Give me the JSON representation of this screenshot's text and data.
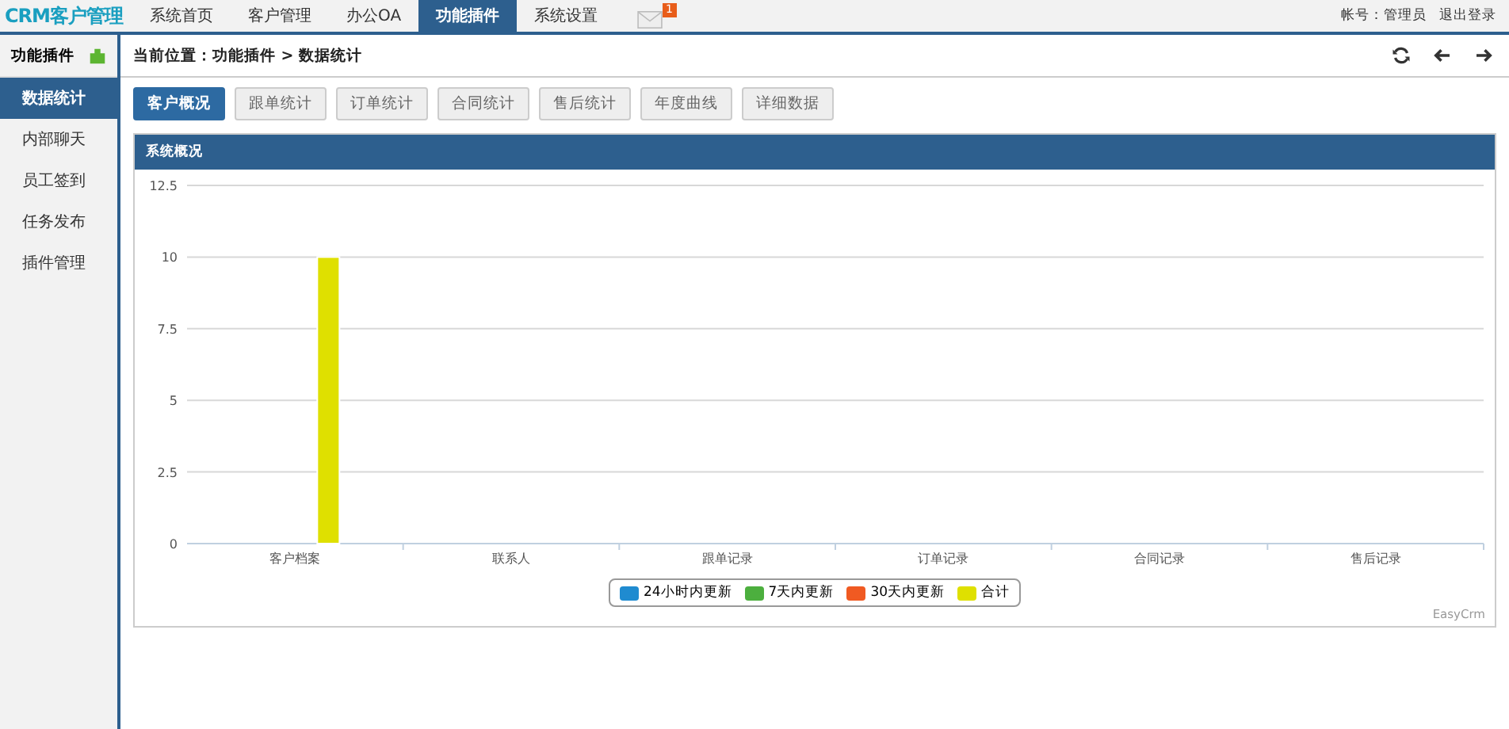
{
  "logo": "CRM客户管理",
  "nav": [
    {
      "label": "系统首页",
      "selected": false
    },
    {
      "label": "客户管理",
      "selected": false
    },
    {
      "label": "办公OA",
      "selected": false
    },
    {
      "label": "功能插件",
      "selected": true
    },
    {
      "label": "系统设置",
      "selected": false
    }
  ],
  "mail_badge": "1",
  "account": {
    "label": "帐号：",
    "name": "管理员",
    "logout": "退出登录"
  },
  "sidebar": {
    "title": "功能插件",
    "items": [
      {
        "label": "数据统计",
        "selected": true
      },
      {
        "label": "内部聊天",
        "selected": false
      },
      {
        "label": "员工签到",
        "selected": false
      },
      {
        "label": "任务发布",
        "selected": false
      },
      {
        "label": "插件管理",
        "selected": false
      }
    ]
  },
  "breadcrumb": "当前位置：功能插件 > 数据统计",
  "tabs": [
    {
      "label": "客户概况",
      "selected": true
    },
    {
      "label": "跟单统计",
      "selected": false
    },
    {
      "label": "订单统计",
      "selected": false
    },
    {
      "label": "合同统计",
      "selected": false
    },
    {
      "label": "售后统计",
      "selected": false
    },
    {
      "label": "年度曲线",
      "selected": false
    },
    {
      "label": "详细数据",
      "selected": false
    }
  ],
  "panel": {
    "title": "系统概况",
    "credit": "EasyCrm",
    "chart_data": {
      "type": "bar",
      "categories": [
        "客户档案",
        "联系人",
        "跟单记录",
        "订单记录",
        "合同记录",
        "售后记录"
      ],
      "series": [
        {
          "name": "24小时内更新",
          "color": "#1f8bd0",
          "values": [
            0,
            0,
            0,
            0,
            0,
            0
          ]
        },
        {
          "name": "7天内更新",
          "color": "#4caf3e",
          "values": [
            0,
            0,
            0,
            0,
            0,
            0
          ]
        },
        {
          "name": "30天内更新",
          "color": "#f05a22",
          "values": [
            0,
            0,
            0,
            0,
            0,
            0
          ]
        },
        {
          "name": "合计",
          "color": "#dfe000",
          "values": [
            10,
            0,
            0,
            0,
            0,
            0
          ]
        }
      ],
      "grid": true,
      "ylim": [
        0,
        12.5
      ],
      "yticks": [
        0,
        2.5,
        5,
        7.5,
        10,
        12.5
      ]
    }
  }
}
